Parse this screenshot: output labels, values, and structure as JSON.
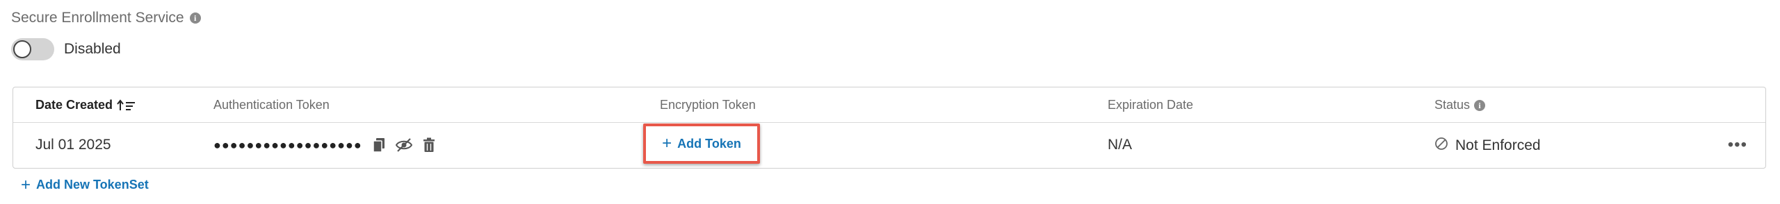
{
  "section": {
    "title": "Secure Enrollment Service",
    "info_icon": "info-icon"
  },
  "toggle": {
    "state": "off",
    "label": "Disabled"
  },
  "table": {
    "columns": [
      {
        "key": "date_created",
        "label": "Date Created",
        "sortable": true
      },
      {
        "key": "auth_token",
        "label": "Authentication Token"
      },
      {
        "key": "encryption_token",
        "label": "Encryption Token"
      },
      {
        "key": "expiration_date",
        "label": "Expiration Date"
      },
      {
        "key": "status",
        "label": "Status",
        "info_icon": "info-icon"
      }
    ],
    "rows": [
      {
        "date_created": "Jul 01 2025",
        "auth_token_masked": "●●●●●●●●●●●●●●●●●●",
        "auth_token_actions": [
          "copy-icon",
          "hide-icon",
          "trash-icon"
        ],
        "encryption_action": "Add Token",
        "expiration_date": "N/A",
        "status": "Not Enforced",
        "status_icon": "not-enforced-icon",
        "more_icon": "more-icon"
      }
    ]
  },
  "footer": {
    "add_tokenset_label": "Add New TokenSet"
  },
  "colors": {
    "link": "#1674b6",
    "highlight": "#e8584a",
    "toggle_track": "#d4d4d4"
  }
}
